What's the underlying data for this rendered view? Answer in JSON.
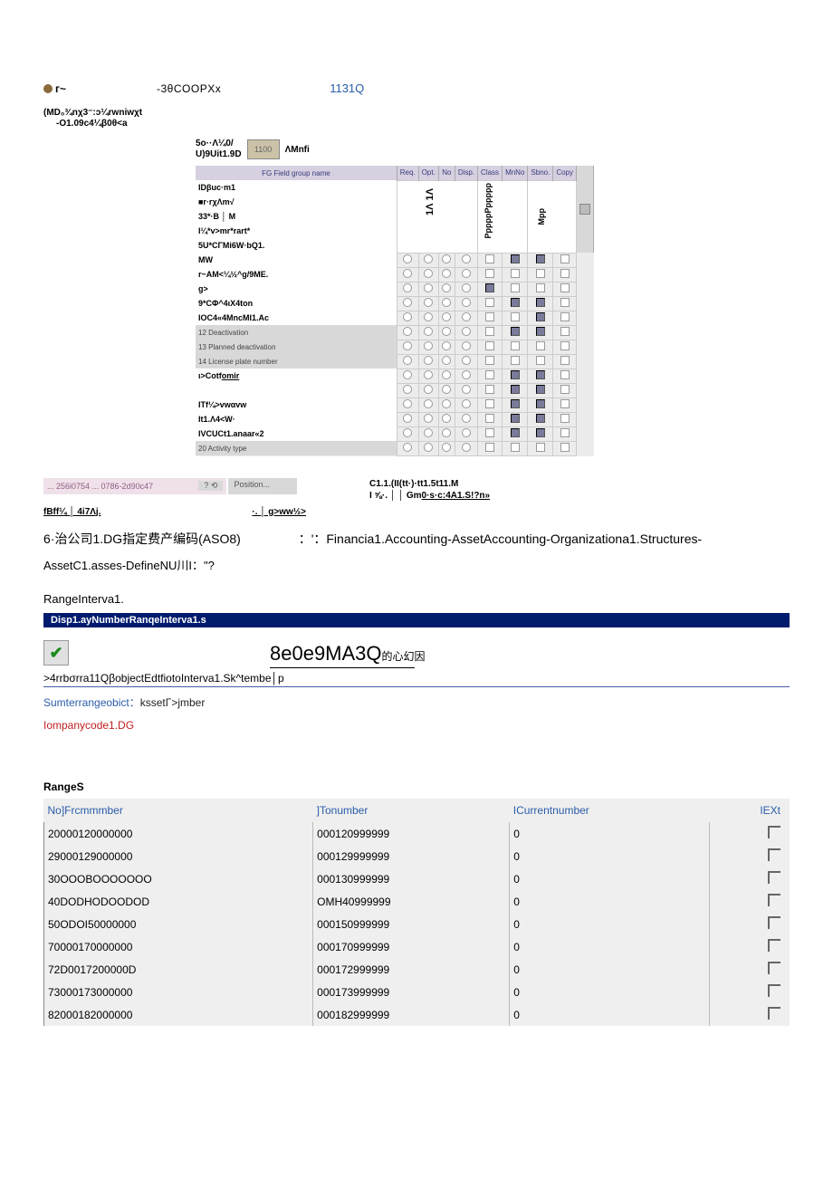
{
  "header": {
    "tilde": "г~",
    "center": "-3θCOOPXx",
    "blue": "1131Q",
    "sub1": "(MD₀¾nχ3⁻:ɔ¼rwniwχt",
    "sub2": "-O1.09c4¼β0θ<a"
  },
  "gridTop": {
    "left1": "5o··Λ¼0/",
    "left2": "U)9Uit1.9D",
    "num": "1100",
    "right": "ΛMnfi"
  },
  "sapHeader": [
    "FG",
    "Field group name",
    "Req.",
    "Opt.",
    "No",
    "Disp.",
    "Class",
    "MnNo",
    "Sbno.",
    "Copy"
  ],
  "sapVert1": "1Λ 1Λ",
  "sapVert2": "PppppPppppp",
  "sapVert3": "Mpp",
  "sapRows": [
    {
      "label": "IDβuc·m1",
      "bg": "w"
    },
    {
      "label": "■r·rχΛm√",
      "bg": "w"
    },
    {
      "label": "33*·B │ M",
      "bg": "w"
    },
    {
      "label": "I¼*v>mr*rart*",
      "bg": "w"
    },
    {
      "label": "5U*CΓMi6W·bQ1.",
      "bg": "w"
    },
    {
      "label": "MW",
      "bg": "w",
      "cks": [
        0,
        1,
        0,
        0,
        0,
        1,
        1,
        0,
        1
      ]
    },
    {
      "label": "r~AM<¼½^g/9ME.",
      "bg": "w",
      "cks": [
        0,
        1,
        0,
        0,
        0,
        0,
        0,
        0,
        0
      ]
    },
    {
      "label": "g>",
      "bg": "w",
      "cks": [
        0,
        1,
        0,
        0,
        1,
        0,
        0,
        0,
        0
      ]
    },
    {
      "label": "9*CΦ^4ιX4ton",
      "bg": "w",
      "cks": [
        0,
        0,
        0,
        1,
        0,
        1,
        1,
        0,
        1
      ]
    },
    {
      "label": "IOC4«4MncMI1.Ac",
      "bg": "w",
      "cks": [
        0,
        0,
        0,
        1,
        0,
        0,
        1,
        0,
        0
      ]
    },
    {
      "label": "12  Deactivation",
      "bg": "g",
      "cks": [
        0,
        1,
        0,
        0,
        0,
        1,
        1,
        0,
        1
      ]
    },
    {
      "label": "13  Planned deactivation",
      "bg": "g",
      "cks": [
        0,
        0,
        1,
        0,
        0,
        0,
        0,
        0,
        0
      ]
    },
    {
      "label": "14  License plate number",
      "bg": "g",
      "cks": [
        0,
        0,
        1,
        0,
        0,
        0,
        0,
        0,
        0
      ]
    },
    {
      "label": "ι>Cotfomir",
      "bg": "w",
      "cks": [
        1,
        0,
        1,
        0,
        0,
        1,
        1,
        0,
        0
      ]
    },
    {
      "label": "",
      "bg": "w",
      "cks": [
        0,
        1,
        1,
        0,
        0,
        1,
        1,
        0,
        0
      ]
    },
    {
      "label": "ITf¼>vwαvw",
      "bg": "w",
      "cks": [
        0,
        1,
        1,
        0,
        0,
        1,
        1,
        0,
        1
      ]
    },
    {
      "label": "It1.Λ4<W·",
      "bg": "w",
      "cks": [
        0,
        1,
        0,
        0,
        0,
        1,
        1,
        0,
        1
      ]
    },
    {
      "label": "IVCUCt1.anaar«2",
      "bg": "w",
      "cks": [
        1,
        1,
        0,
        0,
        0,
        1,
        1,
        0,
        1
      ]
    },
    {
      "label": "20  Activity type",
      "bg": "g",
      "cks": [
        0,
        1,
        0,
        0,
        0,
        0,
        0,
        0,
        0
      ]
    }
  ],
  "midBar": {
    "left": "... 256i0754 ... 0786-2d90c47",
    "icons": "? ⟲",
    "pos": "Position...",
    "rightLine1": "C1.1.(II(tt·)·tt1.5t11.M",
    "rightLine2a": "I ⅝·. │ │ Gm",
    "rightLine2b": "0·s·c:4A1.S!?n»"
  },
  "midLinks": {
    "left": "fBff¼ │ 4i7Λj.",
    "right": "·. │ g>ww½>"
  },
  "body": {
    "p1a": "6·治公司1.DG指定费产编码(ASO8)",
    "p1b": "：'：Financia1.Accounting-AssetAccounting-Organizationa1.Structures-",
    "p2": "AssetC1.asses-DefineNU川I：\"?",
    "p3": "RangeInterva1."
  },
  "titleBar2": "Disp1.ayNumberRanqeInterva1.s",
  "bigTitle": "8e0e9MA3Q",
  "bigSub": "的心幻因",
  "smallLine": ">4rrbσrra11QβobjectEdtfiotoInterva1.Sk^tembe│p",
  "sumLinePrefix": "Sumterrangeobict：",
  "sumLineK": "kssetΓ>jmber",
  "compLine": "Iompanycode1.DG",
  "rangesTitle": "RangeS",
  "rangesHead": [
    "No]Frcmmmber",
    "]Tonumber",
    "ICurrentnumber",
    "IEXt"
  ],
  "rangesRows": [
    {
      "n": "20000120000000",
      "to": "000120999999",
      "cur": "0"
    },
    {
      "n": "29000129000000",
      "to": "000129999999",
      "cur": "0"
    },
    {
      "n": "30OOOBOOOOOOO",
      "to": "000130999999",
      "cur": "0"
    },
    {
      "n": "40DODHODOODOD",
      "to": "OMH40999999",
      "cur": "0"
    },
    {
      "n": "50ODOI50000000",
      "to": "000150999999",
      "cur": "0"
    },
    {
      "n": "70000170000000",
      "to": "000170999999",
      "cur": "0"
    },
    {
      "n": "72D0017200000D",
      "to": "000172999999",
      "cur": "0"
    },
    {
      "n": "73000173000000",
      "to": "000173999999",
      "cur": "0"
    },
    {
      "n": "82000182000000",
      "to": "000182999999",
      "cur": "0"
    }
  ]
}
